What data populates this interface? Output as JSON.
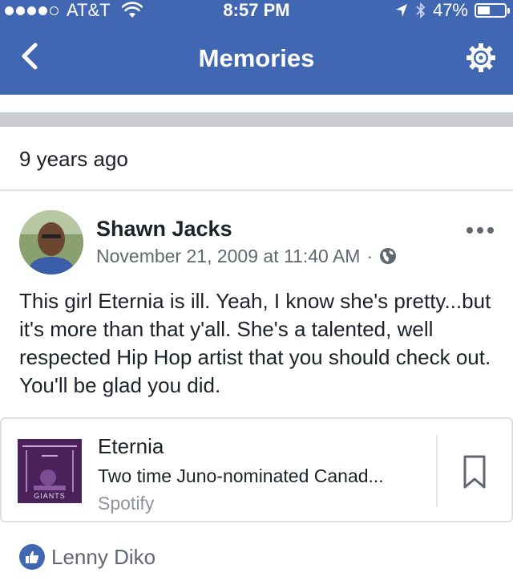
{
  "status_bar": {
    "carrier": "AT&T",
    "signal_bars": 4,
    "signal_max": 5,
    "time": "8:57 PM",
    "battery_percent": "47%",
    "battery_level": 0.47
  },
  "nav": {
    "title": "Memories",
    "back_icon": "chevron-left-icon",
    "settings_icon": "gear-icon"
  },
  "section": {
    "label": "9 years ago"
  },
  "post": {
    "author": "Shawn Jacks",
    "date": "November 21, 2009 at 11:40 AM",
    "separator": "·",
    "privacy_icon": "globe-icon",
    "text": "This girl Eternia is ill.  Yeah, I know she's pretty...but it's more than that y'all.  She's a talented, well respected Hip Hop artist that you should check out.  You'll be glad you did.",
    "link": {
      "title": "Eternia",
      "description": "Two time Juno-nominated Canad...",
      "source": "Spotify",
      "thumbnail_text": "GIANTS"
    }
  },
  "reactions": {
    "icon": "thumbs-up-icon",
    "names": "Lenny Diko"
  },
  "colors": {
    "brand": "#4267b2",
    "text": "#1d2129",
    "secondary": "#616770",
    "separator": "#c9ccd1"
  }
}
